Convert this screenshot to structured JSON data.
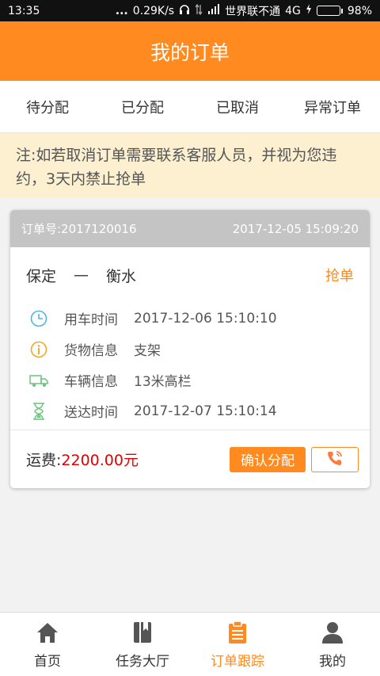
{
  "status_bar": {
    "time": "13:35",
    "dots": "...",
    "speed": "0.29K/s",
    "carrier": "世界联不通",
    "network": "4G",
    "battery_percent": "98%",
    "battery_level": 0.98
  },
  "header": {
    "title": "我的订单"
  },
  "tabs": [
    {
      "label": "待分配",
      "active": true
    },
    {
      "label": "已分配",
      "active": false
    },
    {
      "label": "已取消",
      "active": false
    },
    {
      "label": "异常订单",
      "active": false
    }
  ],
  "notice": "注:如若取消订单需要联系客服人员，并视为您违约，3天内禁止抢单",
  "order": {
    "number": "订单号:2017120016",
    "created": "2017-12-05 15:09:20",
    "from": "保定",
    "dash": "—",
    "to": "衡水",
    "grab_label": "抢单",
    "rows": [
      {
        "icon": "clock-icon",
        "label": "用车时间",
        "value": "2017-12-06 15:10:10"
      },
      {
        "icon": "info-icon",
        "label": "货物信息",
        "value": "支架"
      },
      {
        "icon": "truck-icon",
        "label": "车辆信息",
        "value": "13米高栏"
      },
      {
        "icon": "hourglass-icon",
        "label": "送达时间",
        "value": "2017-12-07 15:10:14"
      }
    ],
    "fee_label": "运费:",
    "fee_value": "2200.00元",
    "confirm_label": "确认分配"
  },
  "bottom_nav": [
    {
      "label": "首页",
      "icon": "home-icon",
      "active": false
    },
    {
      "label": "任务大厅",
      "icon": "book-icon",
      "active": false
    },
    {
      "label": "订单跟踪",
      "icon": "clipboard-icon",
      "active": true
    },
    {
      "label": "我的",
      "icon": "user-icon",
      "active": false
    }
  ],
  "colors": {
    "accent": "#ff8a1f",
    "fee": "#e60000",
    "notice_bg": "#fdf0d0"
  }
}
